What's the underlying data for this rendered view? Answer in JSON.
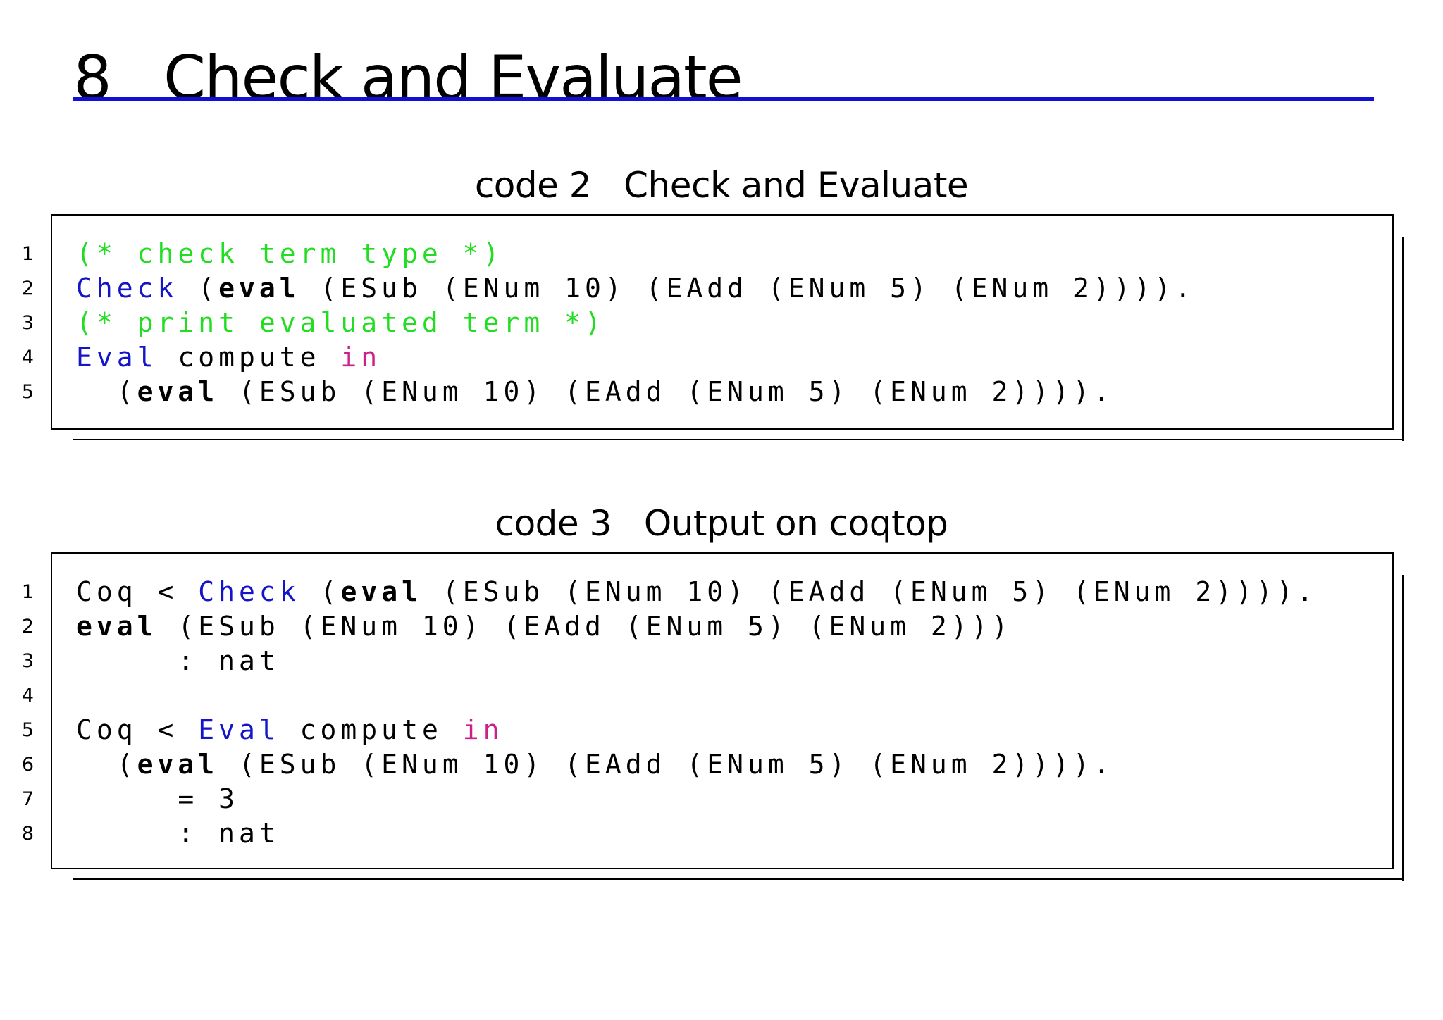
{
  "section": {
    "number": "8",
    "title": "Check and Evaluate",
    "rule_color": "#1010d8"
  },
  "listing1": {
    "caption_label": "code 2",
    "caption_title": "Check and Evaluate",
    "line_numbers": [
      "1",
      "2",
      "3",
      "4",
      "5"
    ],
    "lines": [
      [
        {
          "text": "(* check term type *)",
          "style": "comment"
        }
      ],
      [
        {
          "text": "Check",
          "style": "keyword"
        },
        {
          "text": " (",
          "style": "plain"
        },
        {
          "text": "eval",
          "style": "bold"
        },
        {
          "text": " (ESub (ENum 10) (EAdd (ENum 5) (ENum 2)))).",
          "style": "plain"
        }
      ],
      [
        {
          "text": "(* print evaluated term *)",
          "style": "comment"
        }
      ],
      [
        {
          "text": "Eval",
          "style": "keyword"
        },
        {
          "text": " compute ",
          "style": "plain"
        },
        {
          "text": "in",
          "style": "keyword2"
        }
      ],
      [
        {
          "text": "  (",
          "style": "plain"
        },
        {
          "text": "eval",
          "style": "bold"
        },
        {
          "text": " (ESub (ENum 10) (EAdd (ENum 5) (ENum 2)))).",
          "style": "plain"
        }
      ]
    ]
  },
  "listing2": {
    "caption_label": "code 3",
    "caption_title": "Output on coqtop",
    "line_numbers": [
      "1",
      "2",
      "3",
      "4",
      "5",
      "6",
      "7",
      "8"
    ],
    "lines": [
      [
        {
          "text": "Coq < ",
          "style": "plain"
        },
        {
          "text": "Check",
          "style": "keyword"
        },
        {
          "text": " (",
          "style": "plain"
        },
        {
          "text": "eval",
          "style": "bold"
        },
        {
          "text": " (ESub (ENum 10) (EAdd (ENum 5) (ENum 2)))).",
          "style": "plain"
        }
      ],
      [
        {
          "text": "eval",
          "style": "bold"
        },
        {
          "text": " (ESub (ENum 10) (EAdd (ENum 5) (ENum 2)))",
          "style": "plain"
        }
      ],
      [
        {
          "text": "     : nat",
          "style": "plain"
        }
      ],
      [
        {
          "text": "",
          "style": "plain"
        }
      ],
      [
        {
          "text": "Coq < ",
          "style": "plain"
        },
        {
          "text": "Eval",
          "style": "keyword"
        },
        {
          "text": " compute ",
          "style": "plain"
        },
        {
          "text": "in",
          "style": "keyword2"
        }
      ],
      [
        {
          "text": "  (",
          "style": "plain"
        },
        {
          "text": "eval",
          "style": "bold"
        },
        {
          "text": " (ESub (ENum 10) (EAdd (ENum 5) (ENum 2)))).",
          "style": "plain"
        }
      ],
      [
        {
          "text": "     = 3",
          "style": "plain"
        }
      ],
      [
        {
          "text": "     : nat",
          "style": "plain"
        }
      ]
    ]
  },
  "colors": {
    "comment": "#22dd22",
    "keyword": "#1414c8",
    "keyword2": "#cc1f8a"
  }
}
